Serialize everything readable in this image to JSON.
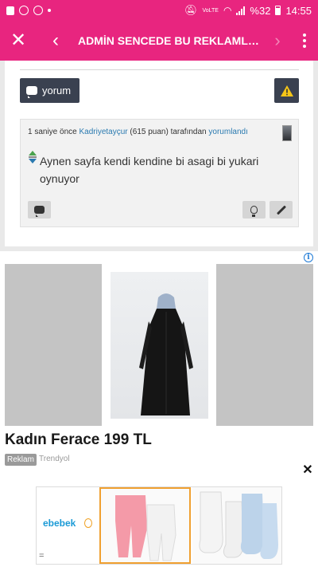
{
  "status_bar": {
    "signal_label": "VoLTE",
    "battery": "%32",
    "time": "14:55"
  },
  "app_bar": {
    "title": "ADMİN SENCEDE BU REKLAMLA..."
  },
  "comment_section": {
    "yorum_label": "yorum",
    "comment": {
      "time_ago": "1 saniye önce",
      "user": "Kadriyetayçur",
      "points": "(615 puan)",
      "by_text": "tarafından",
      "action_link": "yorumlandı",
      "text": "Aynen sayfa kendi kendine bi asagi bi yukari oynuyor"
    }
  },
  "ad": {
    "title": "Kadın Ferace 199 TL",
    "badge": "Reklam",
    "source": "Trendyol"
  },
  "banner": {
    "brand": "ebebek",
    "eq": "="
  },
  "colors": {
    "brand_pink": "#e8257f",
    "dark_button": "#3a4150",
    "link_blue": "#2a7ab0",
    "warning_yellow": "#f5c518"
  }
}
